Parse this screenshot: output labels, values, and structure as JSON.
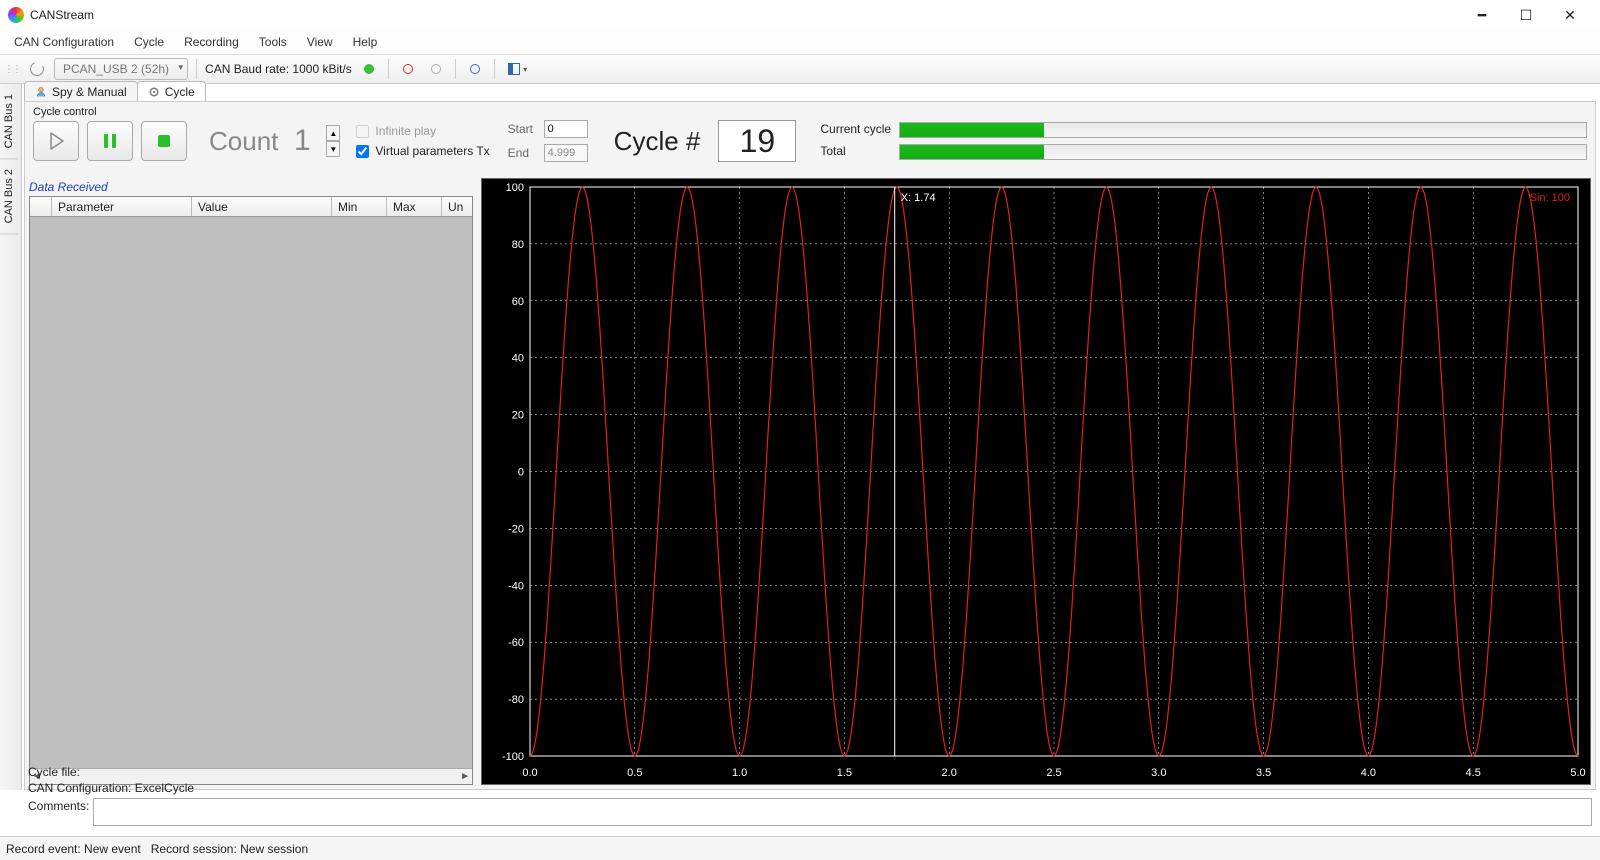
{
  "window": {
    "title": "CANStream"
  },
  "menu": {
    "items": [
      "CAN Configuration",
      "Cycle",
      "Recording",
      "Tools",
      "View",
      "Help"
    ]
  },
  "toolbar": {
    "device": "PCAN_USB 2 (52h)",
    "baud_label": "CAN Baud rate: 1000 kBit/s"
  },
  "vtabs": [
    "CAN Bus 1",
    "CAN Bus 2"
  ],
  "doctabs": {
    "spy": "Spy & Manual",
    "cycle": "Cycle"
  },
  "cycle": {
    "section_label": "Cycle control",
    "count_label": "Count",
    "count_value": "1",
    "infinite_label": "Infinite play",
    "virtual_label": "Virtual parameters Tx",
    "start_label": "Start",
    "end_label": "End",
    "start_value": "0",
    "end_value": "4.999",
    "cycle_num_label": "Cycle #",
    "cycle_num_value": "19",
    "current_label": "Current cycle",
    "total_label": "Total",
    "current_pct": 21,
    "total_pct": 21
  },
  "data_received": {
    "heading": "Data Received",
    "cols": {
      "param": "Parameter",
      "value": "Value",
      "min": "Min",
      "max": "Max",
      "un": "Un"
    }
  },
  "chart_data": {
    "type": "line",
    "xlabel": "",
    "ylabel": "",
    "xlim": [
      0,
      5
    ],
    "ylim": [
      -100,
      100
    ],
    "xticks": [
      0.0,
      0.5,
      1.0,
      1.5,
      2.0,
      2.5,
      3.0,
      3.5,
      4.0,
      4.5,
      5.0
    ],
    "yticks": [
      -100,
      -80,
      -60,
      -40,
      -20,
      0,
      20,
      40,
      60,
      80,
      100
    ],
    "cursor_x": 1.74,
    "cursor_label": "X: 1.74",
    "legend": "Sin: 100",
    "series": [
      {
        "name": "Sin",
        "color": "#d22",
        "amplitude": 100,
        "cycles": 10,
        "phase_deg": -90
      }
    ]
  },
  "footer": {
    "cycle_file": "Cycle file:",
    "can_config": "CAN Configuration: ExcelCycle",
    "comments_label": "Comments:"
  },
  "status": {
    "event": "Record event: New event",
    "session": "Record session: New session"
  }
}
